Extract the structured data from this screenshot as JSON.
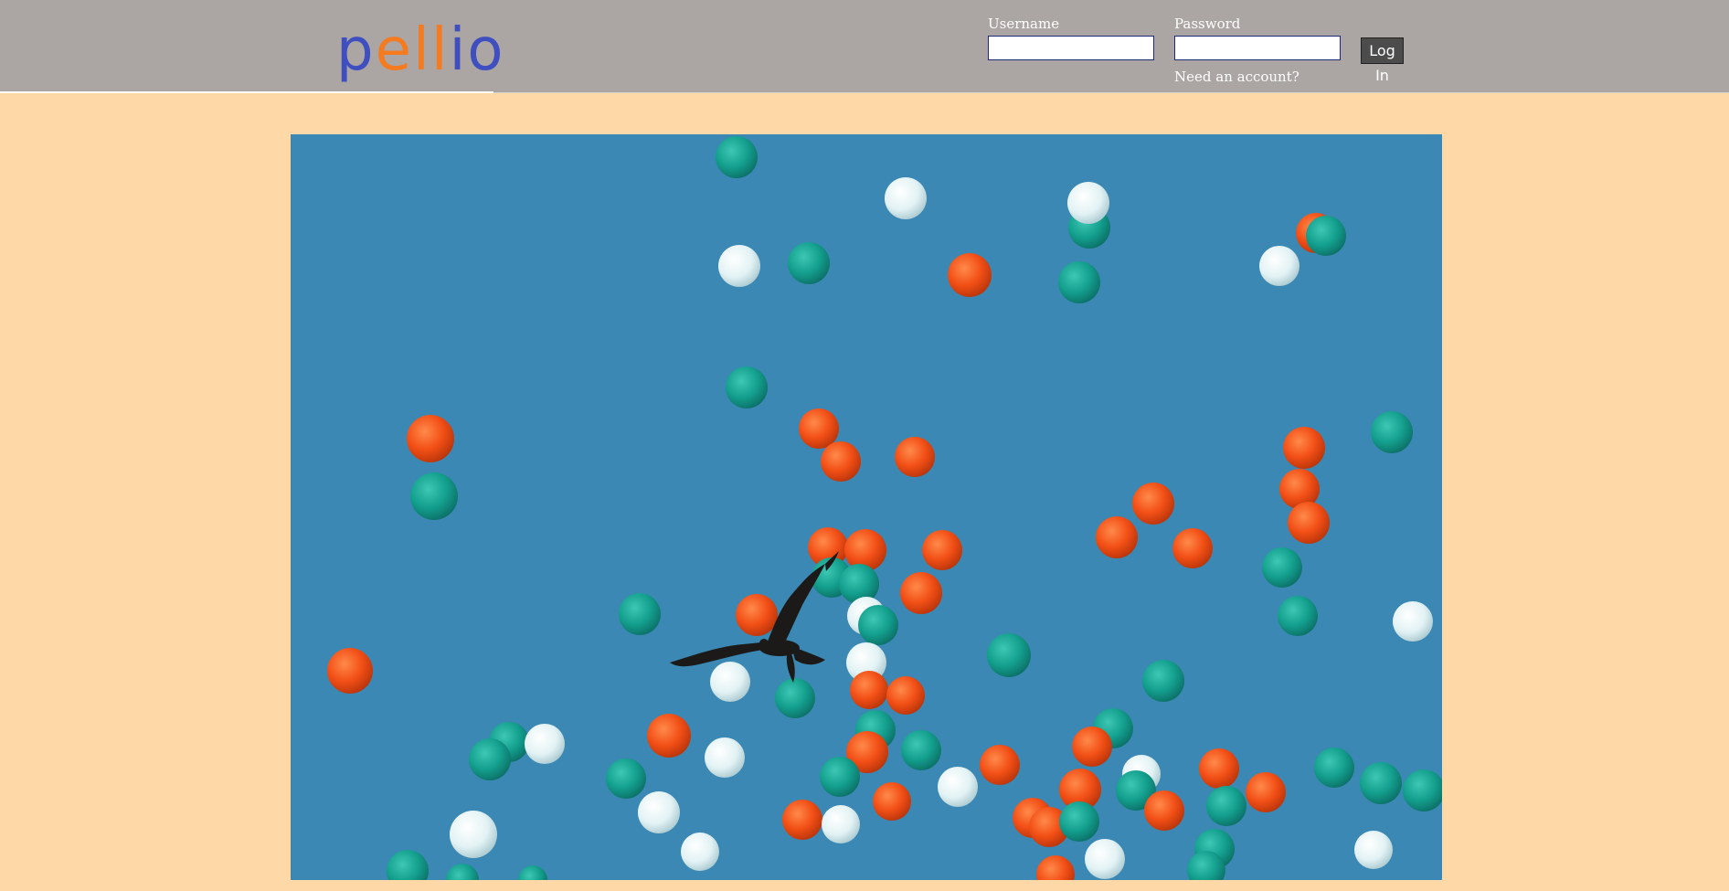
{
  "brand": {
    "logo_letters": [
      {
        "char": "p",
        "color": "#3f4fbf"
      },
      {
        "char": "e",
        "color": "#f47b20"
      },
      {
        "char": "l",
        "color": "#f47b20"
      },
      {
        "char": "l",
        "color": "#f47b20"
      },
      {
        "char": "i",
        "color": "#3f4fbf"
      },
      {
        "char": "o",
        "color": "#3f4fbf"
      }
    ]
  },
  "login": {
    "username_label": "Username",
    "username_value": "",
    "password_label": "Password",
    "password_value": "",
    "submit_label": "Log In",
    "signup_link": "Need an account?"
  },
  "hero": {
    "sky_color": "#3a88b3"
  }
}
